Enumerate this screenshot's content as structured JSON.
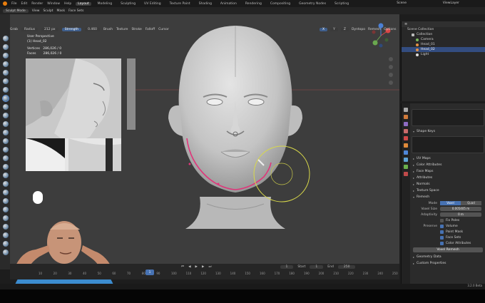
{
  "topbar": {
    "menu": [
      "File",
      "Edit",
      "Render",
      "Window",
      "Help"
    ],
    "workspaces": [
      "Layout",
      "Modeling",
      "Sculpting",
      "UV Editing",
      "Texture Paint",
      "Shading",
      "Animation",
      "Rendering",
      "Compositing",
      "Geometry Nodes",
      "Scripting"
    ],
    "active_workspace": "Layout",
    "scene": "Scene",
    "view_layer": "ViewLayer"
  },
  "header": {
    "mode": "Sculpt Mode",
    "view": "View",
    "sculpt": "Sculpt",
    "mask": "Mask",
    "face_sets": "Face Sets",
    "brush": "Grab",
    "radius_label": "Radius",
    "radius_value": "212 px",
    "strength_label": "Strength",
    "strength_value": "0.460",
    "menus": [
      "Brush",
      "Texture",
      "Stroke",
      "Falloff",
      "Cursor"
    ],
    "symmetry": [
      "X",
      "Y",
      "Z"
    ],
    "dyntopo": "Dyntopo",
    "remesh": "Remesh",
    "options": "Options"
  },
  "viewport_info": {
    "view_name": "User Perspective",
    "object": "(1) Head_02",
    "vertices_label": "Vertices",
    "vertices_value": "286,026 / 0",
    "faces_label": "Faces",
    "faces_value": "286,026 / 0"
  },
  "outliner": {
    "title": "Scene Collection",
    "rows": [
      {
        "label": "Collection",
        "icon": "collection-icon",
        "selected": false,
        "indent": 1
      },
      {
        "label": "Camera",
        "icon": "camera-icon",
        "selected": false,
        "indent": 2
      },
      {
        "label": "Head_01",
        "icon": "mesh-icon",
        "selected": false,
        "indent": 2
      },
      {
        "label": "Head_02",
        "icon": "mesh-icon",
        "selected": true,
        "indent": 2
      },
      {
        "label": "Light",
        "icon": "light-icon",
        "selected": false,
        "indent": 2
      }
    ]
  },
  "properties": {
    "shape_keys": "Shape Keys",
    "sections": [
      "UV Maps",
      "Color Attributes",
      "Face Maps",
      "Attributes",
      "Normals",
      "Texture Space"
    ],
    "remesh": {
      "title": "Remesh",
      "mode_label": "Mode",
      "mode_options": [
        "Voxel",
        "Quad"
      ],
      "mode_selected": "Voxel",
      "voxel_size_label": "Voxel Size",
      "voxel_size_value": "0.005405 m",
      "adaptivity_label": "Adaptivity",
      "adaptivity_value": "0 m",
      "fix_poles": "Fix Poles",
      "preserve_label": "Preserve",
      "preserve_options": [
        "Volume",
        "Paint Mask",
        "Face Sets",
        "Color Attributes"
      ],
      "button": "Voxel Remesh"
    },
    "geometry_data": "Geometry Data",
    "custom_properties": "Custom Properties"
  },
  "timeline": {
    "start_label": "Start",
    "start_value": "1",
    "end_label": "End",
    "end_value": "250",
    "current_frame": "1",
    "ticks": [
      "10",
      "20",
      "30",
      "40",
      "50",
      "60",
      "70",
      "80",
      "90",
      "100",
      "110",
      "120",
      "130",
      "140",
      "150",
      "160",
      "170",
      "180",
      "190",
      "200",
      "210",
      "220",
      "230",
      "240",
      "250"
    ]
  },
  "status": {
    "version": "3.2.0 Beta"
  }
}
